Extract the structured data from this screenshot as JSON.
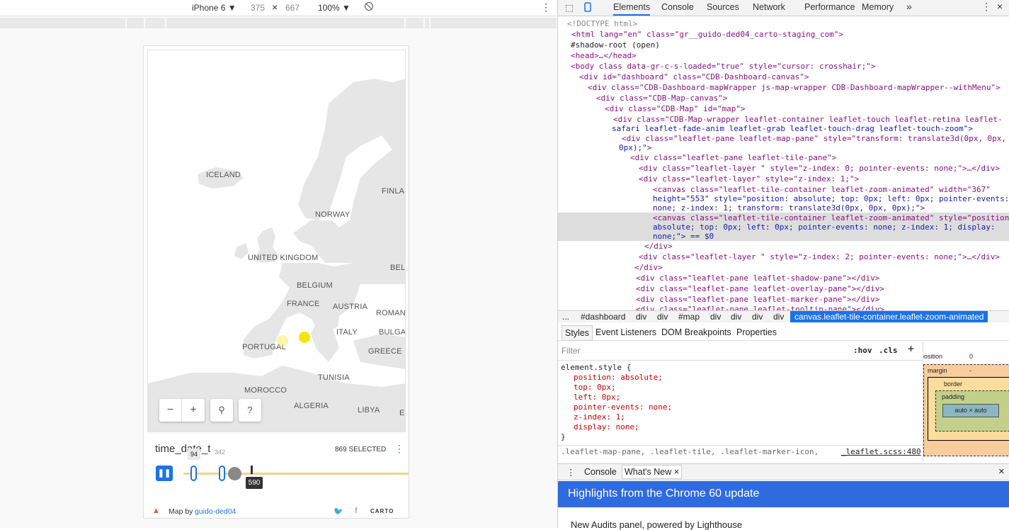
{
  "device_toolbar": {
    "device": "iPhone 6 ▼",
    "width": "375",
    "x": "×",
    "height": "667",
    "zoom": "100% ▼"
  },
  "map": {
    "labels": [
      "ICELAND",
      "FINLAN",
      "NORWAY",
      "UNITED KINGDOM",
      "BELA",
      "BELGIUM",
      "FRANCE",
      "AUSTRIA",
      "ROMANI",
      "ITALY",
      "BULGAR",
      "PORTUGAL",
      "GREECE",
      "TUNISIA",
      "MOROCCO",
      "ALGERIA",
      "LIBYA",
      "EG"
    ],
    "buttons": {
      "zoom_out": "−",
      "zoom_in": "+",
      "search": "⚲",
      "help": "?"
    }
  },
  "widget": {
    "title": "time_date_t",
    "selected": "869 SELECTED",
    "menu": "⋮",
    "tooltip_left": "94",
    "tooltip_right": "342",
    "handle_value": "590",
    "footer": {
      "prefix": "Map by",
      "user": "guido-ded04",
      "brand": "CARTO"
    }
  },
  "devtools": {
    "tabs": [
      "Elements",
      "Console",
      "Sources",
      "Network",
      "Performance",
      "Memory"
    ],
    "more": "»",
    "code": [
      "<!DOCTYPE html>",
      "<html lang=\"en\" class=\"gr__guido-ded04_carto-staging_com\">",
      "#shadow-root (open)",
      "<head>…</head>",
      "<body class data-gr-c-s-loaded=\"true\" style=\"cursor: crosshair;\">",
      "<div id=\"dashboard\" class=\"CDB-Dashboard-canvas\">",
      "<div class=\"CDB-Dashboard-mapWrapper js-map-wrapper CDB-Dashboard-mapWrapper--withMenu\">",
      "<div class=\"CDB-Map-canvas\">",
      "<div class=\"CDB-Map\" id=\"map\">",
      "<div class=\"CDB-Map-wrapper leaflet-container leaflet-touch leaflet-retina leaflet-",
      "safari leaflet-fade-anim leaflet-grab leaflet-touch-drag leaflet-touch-zoom\">",
      "<div class=\"leaflet-pane leaflet-map-pane\" style=\"transform: translate3d(0px, 0px,",
      "0px);\">",
      "<div class=\"leaflet-pane leaflet-tile-pane\">",
      "<div class=\"leaflet-layer \" style=\"z-index: 0; pointer-events: none;\">…</div>",
      "<div class=\"leaflet-layer\" style=\"z-index: 1;\">",
      "<canvas class=\"leaflet-tile-container leaflet-zoom-animated\" width=\"367\"",
      "height=\"553\" style=\"position: absolute; top: 0px; left: 0px; pointer-events:",
      "none; z-index: 1; transform: translate3d(0px, 0px, 0px);\">",
      "<canvas class=\"leaflet-tile-container leaflet-zoom-animated\" style=\"position:",
      "absolute; top: 0px; left: 0px; pointer-events: none; z-index: 1; display:",
      "none;\"> == $0",
      "</div>",
      "<div class=\"leaflet-layer \" style=\"z-index: 2; pointer-events: none;\">…</div>",
      "</div>",
      "<div class=\"leaflet-pane leaflet-shadow-pane\"></div>",
      "<div class=\"leaflet-pane leaflet-overlay-pane\"></div>",
      "<div class=\"leaflet-pane leaflet-marker-pane\"></div>",
      "<div class=\"leaflet-pane leaflet-tooltip-pane\"></div>"
    ],
    "breadcrumbs": [
      "...",
      "#dashboard",
      "div",
      "div",
      "#map",
      "div",
      "div",
      "div",
      "div",
      "canvas.leaflet-tile-container.leaflet-zoom-animated"
    ],
    "sub_tabs": [
      "Styles",
      "Event Listeners",
      "DOM Breakpoints",
      "Properties"
    ],
    "filter_placeholder": "Filter",
    "hov": ":hov",
    "cls": ".cls",
    "plus": "+",
    "styles": [
      "element.style {",
      "position: absolute;",
      "top: 0px;",
      "left: 0px;",
      "pointer-events: none;",
      "z-index: 1;",
      "display: none;",
      "}",
      ".leaflet-map-pane, .leaflet-tile, .leaflet-marker-icon,",
      "_leaflet.scss:480"
    ],
    "box_model": {
      "position": "position",
      "position_val": "0",
      "margin": "margin",
      "border": "border",
      "padding": "padding",
      "content": "auto × auto",
      "dash": "-"
    },
    "drawer_tabs": [
      "Console",
      "What's New"
    ],
    "banner": "Highlights from the Chrome 60 update",
    "whatsnew": "New Audits panel, powered by Lighthouse",
    "colors": {
      "accent": "#1a73e8",
      "banner": "#2e6bde"
    }
  }
}
